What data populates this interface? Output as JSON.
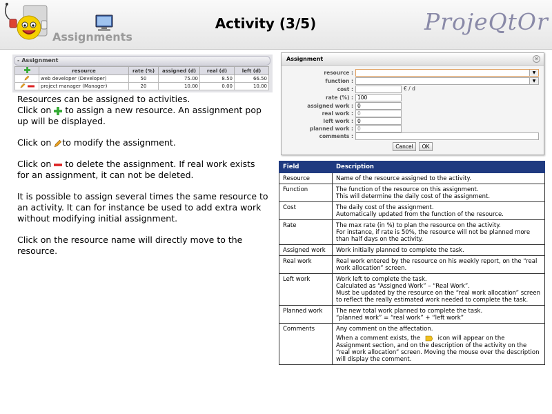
{
  "header": {
    "logo_text": "Assignments",
    "title": "Activity (3/5)",
    "brand": "ProjeQtOr"
  },
  "mini_section": {
    "title": "Assignment",
    "sign": "-",
    "columns": [
      "resource",
      "rate (%)",
      "assigned (d)",
      "real (d)",
      "left (d)"
    ],
    "rows": [
      {
        "resource": "web developer (Developer)",
        "rate": "50",
        "assigned": "75.00",
        "real": "8.50",
        "left": "66.50"
      },
      {
        "resource": "project manager (Manager)",
        "rate": "20",
        "assigned": "10.00",
        "real": "0.00",
        "left": "10.00"
      }
    ]
  },
  "instructions": {
    "p1_line1": "Resources can be assigned to activities.",
    "p1_click": "Click on",
    "p1_rest": "to assign a new resource. An assignment pop up will be displayed.",
    "p2_click": "Click on",
    "p2_rest": "to modify the assignment.",
    "p3_click": "Click on",
    "p3_rest": "to delete the assignment. If real work exists for an assignment, it can not be deleted.",
    "p4": "It is possible to assign several times the same resource to an activity. It can for instance be used to add extra work without modifying initial assignment.",
    "p5": "Click on the resource name will directly move to the resource."
  },
  "dialog": {
    "title": "Assignment",
    "close": "⊗",
    "labels": {
      "resource": "resource :",
      "function": "function :",
      "cost": "cost :",
      "rate": "rate (%) :",
      "assigned_work": "assigned work :",
      "real_work": "real work :",
      "left_work": "left work :",
      "planned_work": "planned work :",
      "comments": "comments :"
    },
    "values": {
      "cost_unit": "€ / d",
      "rate": "100",
      "assigned_work": "0",
      "real_work": "0",
      "left_work": "0",
      "planned_work": "0"
    },
    "cancel_label": "Cancel",
    "ok_label": "OK"
  },
  "table": {
    "header_field": "Field",
    "header_desc": "Description",
    "rows": [
      {
        "field": "Resource",
        "lines": [
          "Name of the resource assigned to the activity."
        ]
      },
      {
        "field": "Function",
        "lines": [
          "The function of the resource on this assignment.",
          "This will determine the daily cost of the assignment."
        ]
      },
      {
        "field": "Cost",
        "lines": [
          "The daily cost of the assignment.",
          "Automatically updated from the function of the resource."
        ]
      },
      {
        "field": "Rate",
        "lines": [
          "The max rate (in %) to plan the resource on the activity.",
          "For instance, if rate is 50%, the resource will not be planned more than half days on the activity."
        ]
      },
      {
        "field": "Assigned work",
        "lines": [
          "Work initially planned to complete the task."
        ]
      },
      {
        "field": "Real work",
        "lines": [
          "Real work entered by the resource on his weekly report, on the “real work allocation” screen."
        ]
      },
      {
        "field": "Left work",
        "lines": [
          "Work left to complete the task.",
          "Calculated as “Assigned Work” – “Real Work”.",
          "Must be updated by the resource on the “real work allocation” screen to reflect the really estimated work needed to complete the task."
        ]
      },
      {
        "field": "Planned work",
        "lines": [
          "The new total work planned to complete the task.",
          "“planned work” = “real work” + “left work”"
        ]
      },
      {
        "field": "Comments",
        "lines": [
          "Any comment on the affectation."
        ],
        "extra_before": "When a comment exists, the",
        "extra_after": "icon will appear on the Assignment section, and on the description of the activity on the “real work allocation” screen. Moving the mouse over the description will display the comment."
      }
    ]
  },
  "colors": {
    "table_header_bg": "#1f3a80",
    "brand": "#8a8aa8"
  }
}
